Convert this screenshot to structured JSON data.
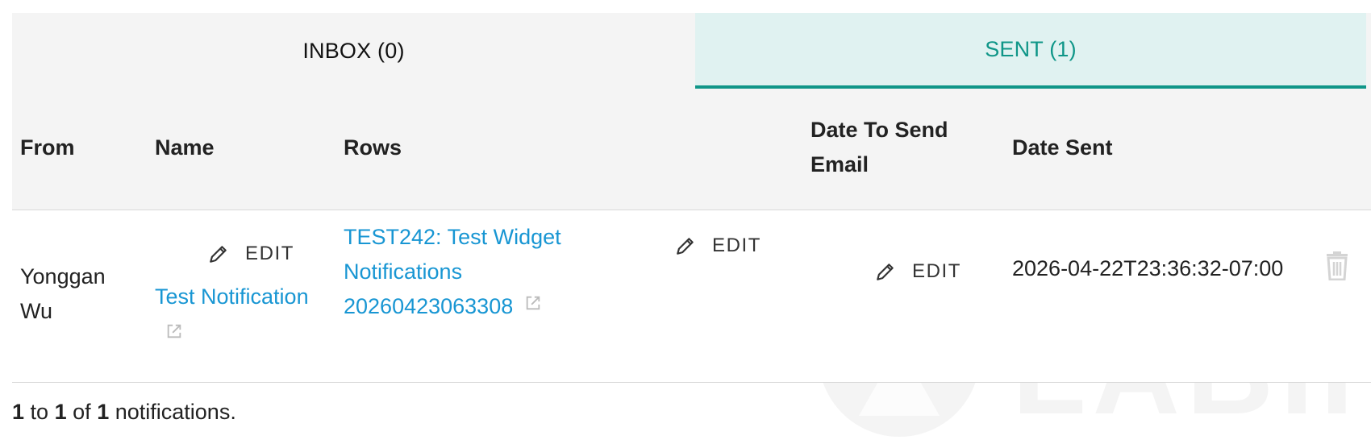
{
  "tabs": {
    "inbox_label": "INBOX (0)",
    "sent_label": "SENT (1)"
  },
  "table": {
    "headers": {
      "from": "From",
      "name": "Name",
      "rows": "Rows",
      "date_to_send_line1": "Date To Send",
      "date_to_send_line2": "Email",
      "date_sent": "Date Sent"
    },
    "row": {
      "from_line1": "Yonggan",
      "from_line2": "Wu",
      "name_edit_label": "EDIT",
      "name_link": "Test Notification",
      "rows_link_line1": "TEST242: Test Widget",
      "rows_link_line2": "Notifications",
      "rows_link_line3": "20260423063308",
      "rows_edit_label": "EDIT",
      "date_to_send_edit_label": "EDIT",
      "date_sent": "2026-04-22T23:36:32-07:00"
    }
  },
  "footer": {
    "from": "1",
    "to_word": "to",
    "to": "1",
    "of_word": "of",
    "total": "1",
    "suffix": "notifications."
  },
  "watermark": {
    "text": "LABII"
  },
  "colors": {
    "accent": "#0f9688",
    "accent_bg": "#e0f2f1",
    "link": "#1896d3",
    "header_bg": "#f4f4f4"
  },
  "icons": {
    "edit": "pencil-icon",
    "external": "external-link-icon",
    "delete": "trash-icon"
  }
}
